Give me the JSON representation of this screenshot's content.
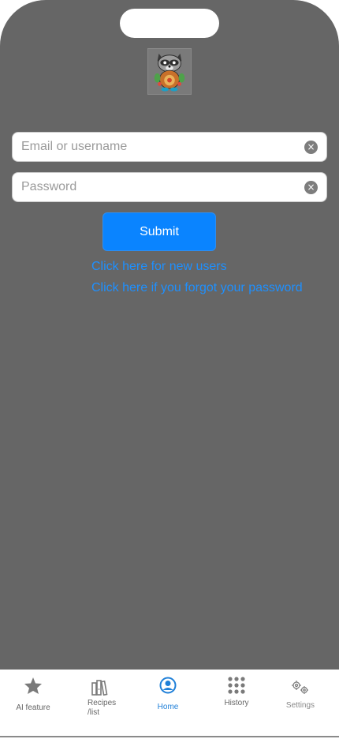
{
  "login": {
    "email_placeholder": "Email or username",
    "password_placeholder": "Password",
    "clear_icon": "×",
    "submit_label": "Submit",
    "new_user_link": "Click here for new users",
    "forgot_password_link": "Click here if you forgot your password"
  },
  "tabbar": {
    "tabs": [
      {
        "label": "AI feature",
        "icon": "star-icon",
        "active": false
      },
      {
        "label": "Recipes\n/list",
        "icon": "books-icon",
        "active": false
      },
      {
        "label": "Home",
        "icon": "user-circle-icon",
        "active": true
      },
      {
        "label": "History",
        "icon": "grid-dots-icon",
        "active": false
      },
      {
        "label": "Settings",
        "icon": "gears-icon",
        "active": false
      }
    ]
  },
  "colors": {
    "background": "#666666",
    "accent": "#0a84ff",
    "link": "#1e90ff",
    "active_tab": "#1e7fd8",
    "inactive_tab": "#666666"
  }
}
